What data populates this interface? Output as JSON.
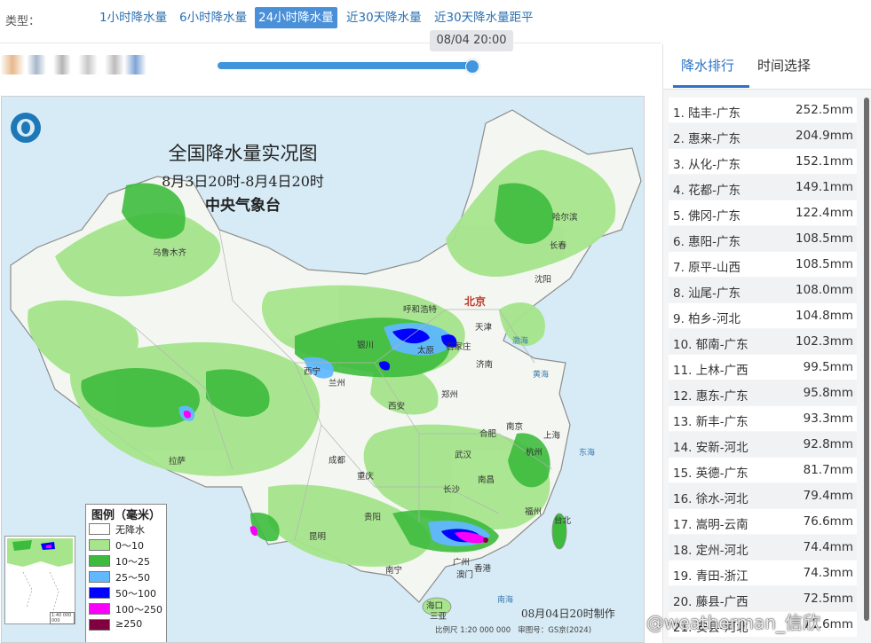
{
  "typebar": {
    "label": "类型：",
    "types": [
      {
        "label": "1小时降水量",
        "active": false
      },
      {
        "label": "6小时降水量",
        "active": false
      },
      {
        "label": "24小时降水量",
        "active": true
      },
      {
        "label": "近30天降水量",
        "active": false
      },
      {
        "label": "近30天降水量距平",
        "active": false
      }
    ]
  },
  "timeline": {
    "current_time": "08/04 20:00",
    "progress": 1.0
  },
  "map": {
    "title": "全国降水量实况图",
    "period": "8月3日20时-8月4日20时",
    "agency": "中央气象台",
    "produced": "08月04日20时制作",
    "scale": "比例尺 1:20 000 000",
    "review_no": "审图号：GS京(2024)",
    "inset_scale": "1:40 000 000",
    "capital": "北京",
    "cities": [
      "乌鲁木齐",
      "哈尔滨",
      "长春",
      "沈阳",
      "呼和浩特",
      "天津",
      "银川",
      "太原",
      "石家庄",
      "济南",
      "西宁",
      "兰州",
      "郑州",
      "西安",
      "南京",
      "合肥",
      "上海",
      "杭州",
      "武汉",
      "成都",
      "重庆",
      "拉萨",
      "长沙",
      "南昌",
      "福州",
      "贵阳",
      "昆明",
      "台北",
      "南宁",
      "广州",
      "香港",
      "澳门",
      "海口",
      "三亚"
    ],
    "seas": [
      "渤海",
      "黄海",
      "东海",
      "南海"
    ]
  },
  "legend": {
    "title": "图例（毫米）",
    "items": [
      {
        "label": "无降水",
        "color": "#ffffff"
      },
      {
        "label": "0～10",
        "color": "#a6e58c"
      },
      {
        "label": "10～25",
        "color": "#3dbb3d"
      },
      {
        "label": "25～50",
        "color": "#61b8ff"
      },
      {
        "label": "50～100",
        "color": "#0000fe"
      },
      {
        "label": "100～250",
        "color": "#fa00fa"
      },
      {
        "label": "≥250",
        "color": "#800040"
      }
    ]
  },
  "panel": {
    "tabs": [
      {
        "label": "降水排行",
        "active": true
      },
      {
        "label": "时间选择",
        "active": false
      }
    ],
    "ranking": [
      {
        "name": "1. 陆丰-广东",
        "value": "252.5mm"
      },
      {
        "name": "2. 惠来-广东",
        "value": "204.9mm"
      },
      {
        "name": "3. 从化-广东",
        "value": "152.1mm"
      },
      {
        "name": "4. 花都-广东",
        "value": "149.1mm"
      },
      {
        "name": "5. 佛冈-广东",
        "value": "122.4mm"
      },
      {
        "name": "6. 惠阳-广东",
        "value": "108.5mm"
      },
      {
        "name": "7. 原平-山西",
        "value": "108.5mm"
      },
      {
        "name": "8. 汕尾-广东",
        "value": "108.0mm"
      },
      {
        "name": "9. 柏乡-河北",
        "value": "104.8mm"
      },
      {
        "name": "10. 郁南-广东",
        "value": "102.3mm"
      },
      {
        "name": "11. 上林-广西",
        "value": "99.5mm"
      },
      {
        "name": "12. 惠东-广东",
        "value": "95.8mm"
      },
      {
        "name": "13. 新丰-广东",
        "value": "93.3mm"
      },
      {
        "name": "14. 安新-河北",
        "value": "92.8mm"
      },
      {
        "name": "15. 英德-广东",
        "value": "81.7mm"
      },
      {
        "name": "16. 徐水-河北",
        "value": "79.4mm"
      },
      {
        "name": "17. 嵩明-云南",
        "value": "76.6mm"
      },
      {
        "name": "18. 定州-河北",
        "value": "74.4mm"
      },
      {
        "name": "19. 青田-浙江",
        "value": "74.3mm"
      },
      {
        "name": "20. 藤县-广西",
        "value": "72.5mm"
      },
      {
        "name": "21. 安县-河北",
        "value": "71.6mm"
      }
    ]
  },
  "watermark": "@weatherman_信欣"
}
